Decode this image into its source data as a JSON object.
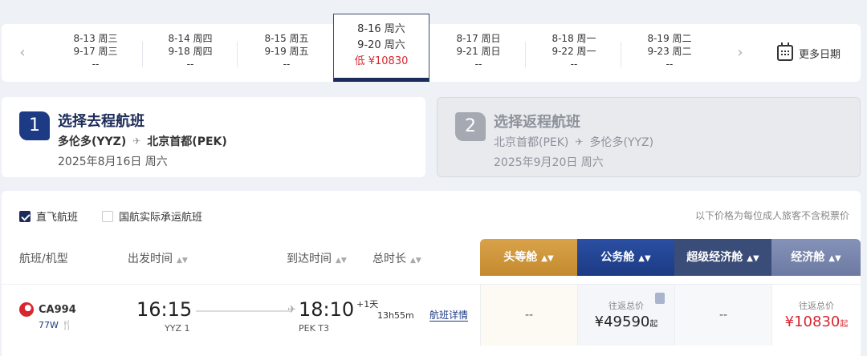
{
  "date_strip": {
    "prev_label": "‹",
    "next_label": "›",
    "dates": [
      {
        "depart": "8-13 周三",
        "return": "9-17 周三",
        "price": "--",
        "active": false
      },
      {
        "depart": "8-14 周四",
        "return": "9-18 周四",
        "price": "--",
        "active": false
      },
      {
        "depart": "8-15 周五",
        "return": "9-19 周五",
        "price": "--",
        "active": false
      },
      {
        "depart": "8-16 周六",
        "return": "9-20 周六",
        "price": "低 ¥10830",
        "active": true
      },
      {
        "depart": "8-17 周日",
        "return": "9-21 周日",
        "price": "--",
        "active": false
      },
      {
        "depart": "8-18 周一",
        "return": "9-22 周一",
        "price": "--",
        "active": false
      },
      {
        "depart": "8-19 周二",
        "return": "9-23 周二",
        "price": "--",
        "active": false
      }
    ],
    "more_dates_label": "更多日期"
  },
  "steps": [
    {
      "number": "1",
      "title": "选择去程航班",
      "from": "多伦多(YYZ)",
      "to": "北京首都(PEK)",
      "date": "2025年8月16日 周六"
    },
    {
      "number": "2",
      "title": "选择返程航班",
      "from": "北京首都(PEK)",
      "to": "多伦多(YYZ)",
      "date": "2025年9月20日 周六"
    }
  ],
  "filters": {
    "direct_label": "直飞航班",
    "direct_checked": true,
    "air_china_label": "国航实际承运航班",
    "air_china_checked": false,
    "price_note": "以下价格为每位成人旅客不含税票价"
  },
  "columns": {
    "flight": "航班/机型",
    "depart": "出发时间",
    "arrive": "到达时间",
    "duration": "总时长"
  },
  "cabins": {
    "first": "头等舱",
    "business": "公务舱",
    "premium": "超级经济舱",
    "economy": "经济舱"
  },
  "flight": {
    "number": "CA994",
    "aircraft": "77W",
    "depart_time": "16:15",
    "depart_airport": "YYZ 1",
    "arrive_time": "18:10",
    "arrive_airport": "PEK T3",
    "next_day": "+1天",
    "duration": "13h55m",
    "details_link": "航班详情",
    "first_price": "--",
    "business_label": "往返总价",
    "business_price": "¥49590",
    "business_suffix": "起",
    "premium_price": "--",
    "economy_label": "往返总价",
    "economy_price": "¥10830",
    "economy_suffix": "起"
  },
  "colors": {
    "brand_navy": "#1c2b5a",
    "price_red": "#d7262f",
    "first_gold": "#c48a2e",
    "business_blue": "#1c3a84"
  }
}
